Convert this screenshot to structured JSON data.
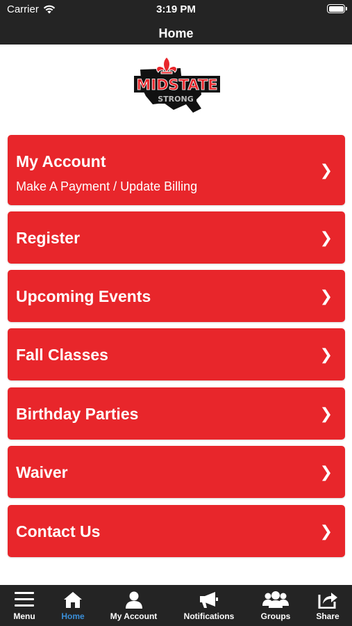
{
  "status_bar": {
    "carrier": "Carrier",
    "time": "3:19 PM"
  },
  "nav": {
    "title": "Home"
  },
  "logo": {
    "text_main": "MIDSTATE",
    "text_sub": "STRONG"
  },
  "menu": [
    {
      "label": "My Account",
      "sublabel": "Make A Payment / Update Billing"
    },
    {
      "label": "Register"
    },
    {
      "label": "Upcoming Events"
    },
    {
      "label": "Fall Classes"
    },
    {
      "label": "Birthday Parties"
    },
    {
      "label": "Waiver"
    },
    {
      "label": "Contact Us"
    }
  ],
  "chevron": "❯",
  "tabs": [
    {
      "label": "Menu",
      "icon": "hamburger-icon"
    },
    {
      "label": "Home",
      "icon": "house-icon",
      "active": true
    },
    {
      "label": "My Account",
      "icon": "person-icon"
    },
    {
      "label": "Notifications",
      "icon": "megaphone-icon"
    },
    {
      "label": "Groups",
      "icon": "group-icon"
    },
    {
      "label": "Share",
      "icon": "share-icon"
    }
  ],
  "colors": {
    "header": "#242424",
    "tile": "#e8262b",
    "active_tab": "#3a8fd9"
  }
}
